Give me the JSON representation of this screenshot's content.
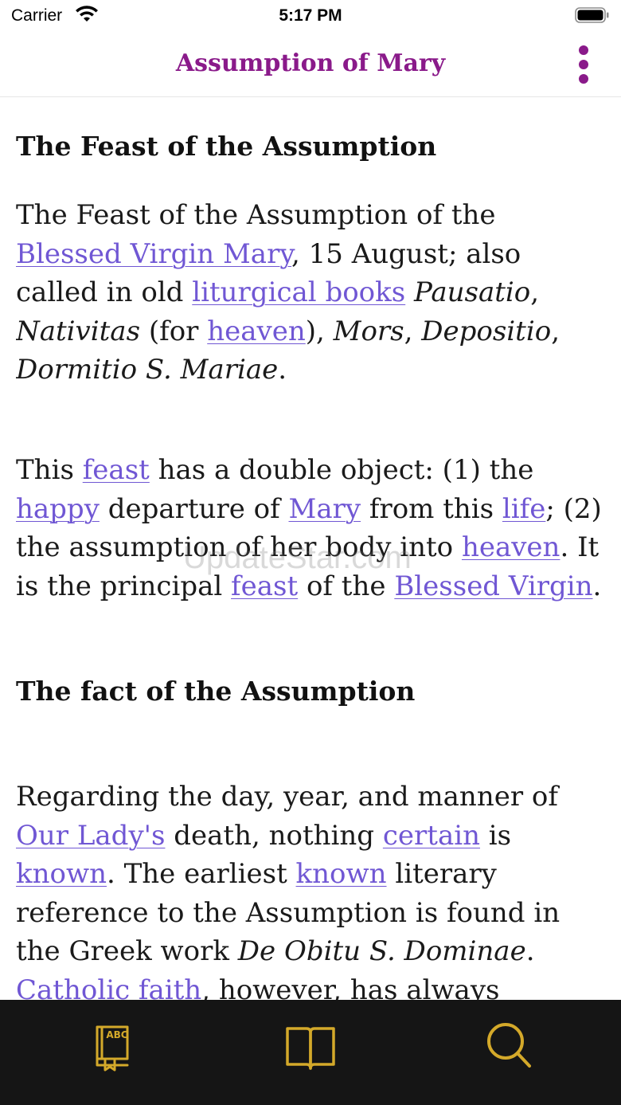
{
  "status_bar": {
    "carrier": "Carrier",
    "time": "5:17 PM"
  },
  "nav": {
    "title": "Assumption of Mary"
  },
  "article": {
    "heading1": "The Feast of the Assumption",
    "p1": {
      "t1": "The Feast of the Assumption of the ",
      "link1": "Blessed Virgin Mary",
      "t2": ", 15 August; also called in old ",
      "link2": "liturgical books",
      "t3": " ",
      "em1": "Pausatio",
      "t4": ", ",
      "em2": "Nativitas",
      "t5": " (for ",
      "link3": "heaven",
      "t6": "), ",
      "em3": "Mors",
      "t7": ", ",
      "em4": "Depositio",
      "t8": ", ",
      "em5": "Dormitio S. Mariae",
      "t9": "."
    },
    "p2": {
      "t1": "This ",
      "link1": "feast",
      "t2": " has a double object: (1) the ",
      "link2": "happy",
      "t3": " departure of ",
      "link3": "Mary",
      "t4": " from this ",
      "link4": "life",
      "t5": "; (2) the assumption of her body into ",
      "link5": "heaven",
      "t6": ". It is the principal ",
      "link6": "feast",
      "t7": " of the ",
      "link7": "Blessed Virgin",
      "t8": "."
    },
    "heading2": "The fact of the Assumption",
    "p3": {
      "t1": "Regarding the day, year, and manner of ",
      "link1": "Our Lady's",
      "t2": " death, nothing ",
      "link2": "certain",
      "t3": " is ",
      "link3": "known",
      "t4": ". The earliest ",
      "link4": "known",
      "t5": " literary reference to the Assumption is found in the Greek work ",
      "em1": "De Obitu S. Dominae",
      "t6": ". ",
      "link5": "Catholic faith",
      "t7": ", however, has always"
    }
  },
  "watermark": "UpdateStar.com",
  "tab_bar": {
    "accent_color": "#d4a92a",
    "dictionary_icon_text": "ABC",
    "tabs": [
      "dictionary-icon",
      "book-icon",
      "search-icon"
    ]
  }
}
